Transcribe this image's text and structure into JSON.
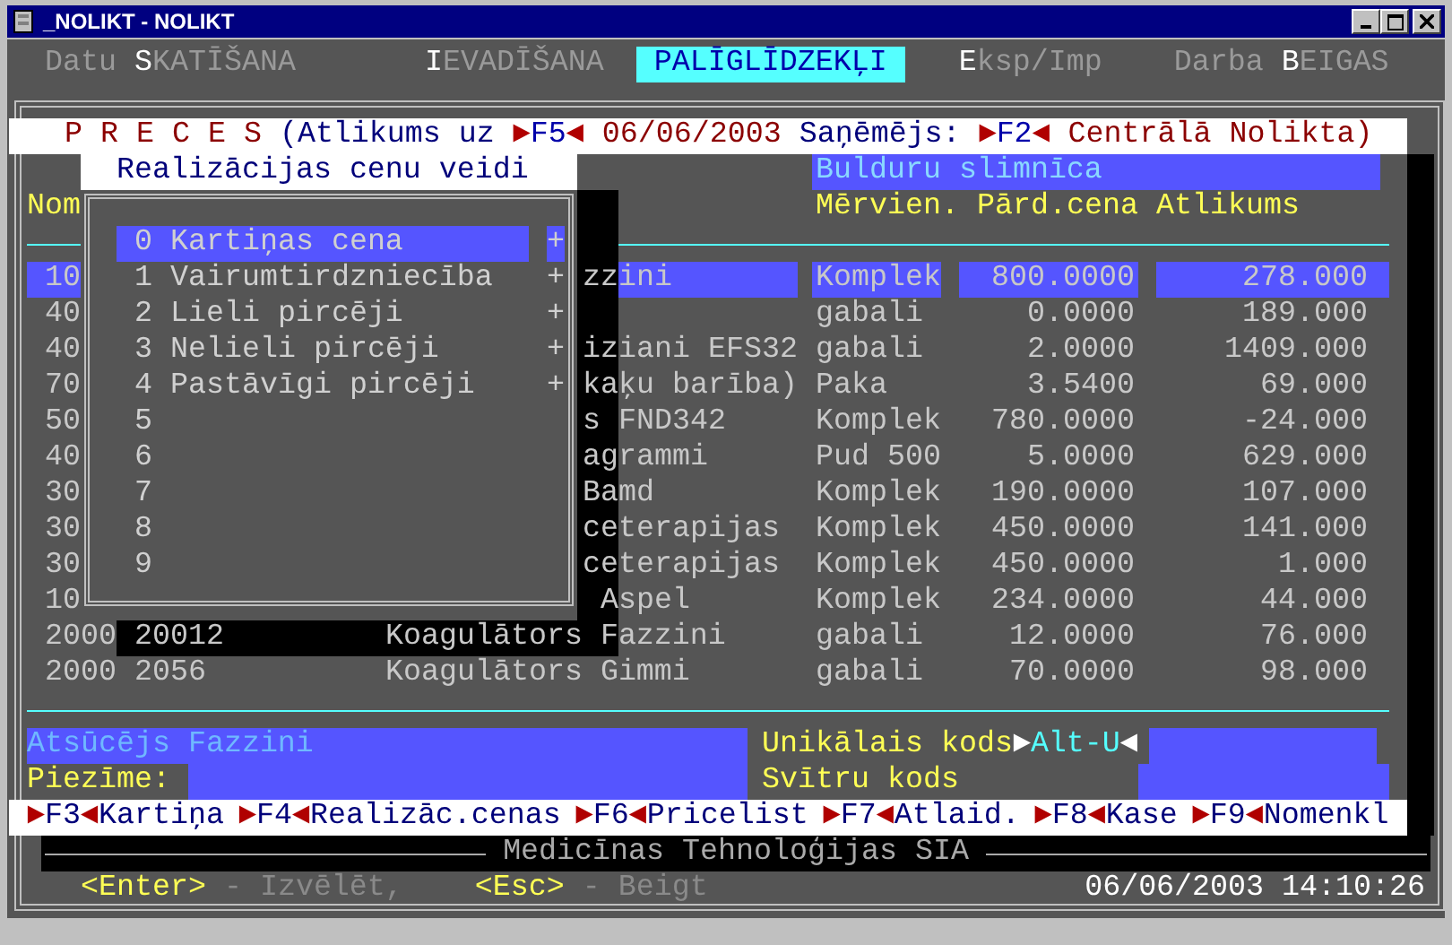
{
  "window": {
    "title": "_NOLIKT - NOLIKT"
  },
  "menu": [
    {
      "label": "Datu **S**KATĪŠANA",
      "selected": false
    },
    {
      "label": "**I**EVADĪŠANA",
      "selected": false
    },
    {
      "label": "PALĪGLĪDZEKĻI",
      "selected": true
    },
    {
      "label": "**E**ksp/Imp",
      "selected": false
    },
    {
      "label": "Darba **B**EIGAS",
      "selected": false
    }
  ],
  "header": [
    {
      "kind": "title",
      "text": "P R E C E S"
    },
    {
      "kind": "label",
      "text": " (Atlikums uz "
    },
    {
      "kind": "arrow",
      "text": "►"
    },
    {
      "kind": "key",
      "text": "F5"
    },
    {
      "kind": "arrow",
      "text": "◄"
    },
    {
      "kind": "value",
      "text": " 06/06/2003 "
    },
    {
      "kind": "label",
      "text": "Saņēmējs: "
    },
    {
      "kind": "arrow",
      "text": "►"
    },
    {
      "kind": "key",
      "text": "F2"
    },
    {
      "kind": "arrow",
      "text": "◄"
    },
    {
      "kind": "value",
      "text": " Centrālā Nolikta)"
    }
  ],
  "customer": "Bulduru slimnīca",
  "popup": {
    "title": "Realizācijas cenu veidi",
    "items": [
      {
        "number": "0",
        "label": "Kartiņas cena",
        "marker": "+",
        "selected": true
      },
      {
        "number": "1",
        "label": "Vairumtirdzniecība",
        "marker": "+",
        "selected": false
      },
      {
        "number": "2",
        "label": "Lieli pircēji",
        "marker": "+",
        "selected": false
      },
      {
        "number": "3",
        "label": "Nelieli pircēji",
        "marker": "+",
        "selected": false
      },
      {
        "number": "4",
        "label": "Pastāvīgi pircēji",
        "marker": "+",
        "selected": false
      },
      {
        "number": "5",
        "selected": false
      },
      {
        "number": "6",
        "selected": false
      },
      {
        "number": "7",
        "selected": false
      },
      {
        "number": "8",
        "selected": false
      },
      {
        "number": "9",
        "selected": false
      }
    ]
  },
  "table": {
    "columns": [
      "Nom",
      "Mērvien.",
      "Pārd.cena",
      "Atlikums"
    ],
    "rows": [
      {
        "code": "10",
        "name": "zzini",
        "unit": "Komplek",
        "price": "800.0000",
        "stock": "278.000",
        "selected": true,
        "shadowed": true
      },
      {
        "code": "40",
        "unit": "gabali",
        "price": "0.0000",
        "stock": "189.000",
        "selected": false,
        "shadowed": true
      },
      {
        "code": "40",
        "name": "iziani EFS32",
        "unit": "gabali",
        "price": "2.0000",
        "stock": "1409.000",
        "selected": false,
        "shadowed": true
      },
      {
        "code": "70",
        "name": "kaķu barība)",
        "unit": "Paka",
        "price": "3.5400",
        "stock": "69.000",
        "selected": false,
        "shadowed": true
      },
      {
        "code": "50",
        "name": "s FND342",
        "unit": "Komplek",
        "price": "780.0000",
        "stock": "-24.000",
        "selected": false,
        "shadowed": true
      },
      {
        "code": "40",
        "name": "agrammi",
        "unit": "Pud 500",
        "price": "5.0000",
        "stock": "629.000",
        "selected": false,
        "shadowed": true
      },
      {
        "code": "30",
        "name": "Bamd",
        "unit": "Komplek",
        "price": "190.0000",
        "stock": "107.000",
        "selected": false,
        "shadowed": true
      },
      {
        "code": "30",
        "name": "ceterapijas",
        "unit": "Komplek",
        "price": "450.0000",
        "stock": "141.000",
        "selected": false,
        "shadowed": true
      },
      {
        "code": "30",
        "name": "ceterapijas",
        "unit": "Komplek",
        "price": "450.0000",
        "stock": "1.000",
        "selected": false,
        "shadowed": true
      },
      {
        "code": "10",
        "name": " Aspel",
        "unit": "Komplek",
        "price": "234.0000",
        "stock": "44.000",
        "selected": false,
        "shadowed": true
      },
      {
        "code": "2000",
        "article": "20012",
        "name": "Koagulātors Fazzini",
        "unit": "gabali",
        "price": "12.0000",
        "stock": "76.000",
        "selected": false,
        "shadowed": true
      },
      {
        "code": "2000",
        "article": "2056",
        "name": "Koagulātors Gimmi",
        "unit": "gabali",
        "price": "70.0000",
        "stock": "98.000",
        "selected": false,
        "shadowed": false
      }
    ]
  },
  "details": {
    "producer": "Atsūcējs Fazzini",
    "note_label": "Piezīme:",
    "unique_code_label": "Unikālais kods",
    "unique_code_hotkey": {
      "before": "►",
      "key": "Alt-U",
      "after": "◄"
    },
    "barcode_label": "Svītru kods"
  },
  "function_keys": [
    {
      "key": "F3",
      "label": "Kartiņa"
    },
    {
      "key": "F4",
      "label": "Realizāc.cenas"
    },
    {
      "key": "F6",
      "label": "Pricelist"
    },
    {
      "key": "F7",
      "label": "Atlaid."
    },
    {
      "key": "F8",
      "label": "Kase"
    },
    {
      "key": "F9",
      "label": "Nomenkl"
    }
  ],
  "function_key_arrows": {
    "before": "►",
    "after": "◄"
  },
  "company": "Medicīnas Tehnoloģijas SIA",
  "hints": [
    {
      "key": "<Enter>",
      "text": " - Izvēlēt,"
    },
    {
      "key": "<Esc>",
      "text": " - Beigt"
    }
  ],
  "datetime": "06/06/2003 14:10:26"
}
